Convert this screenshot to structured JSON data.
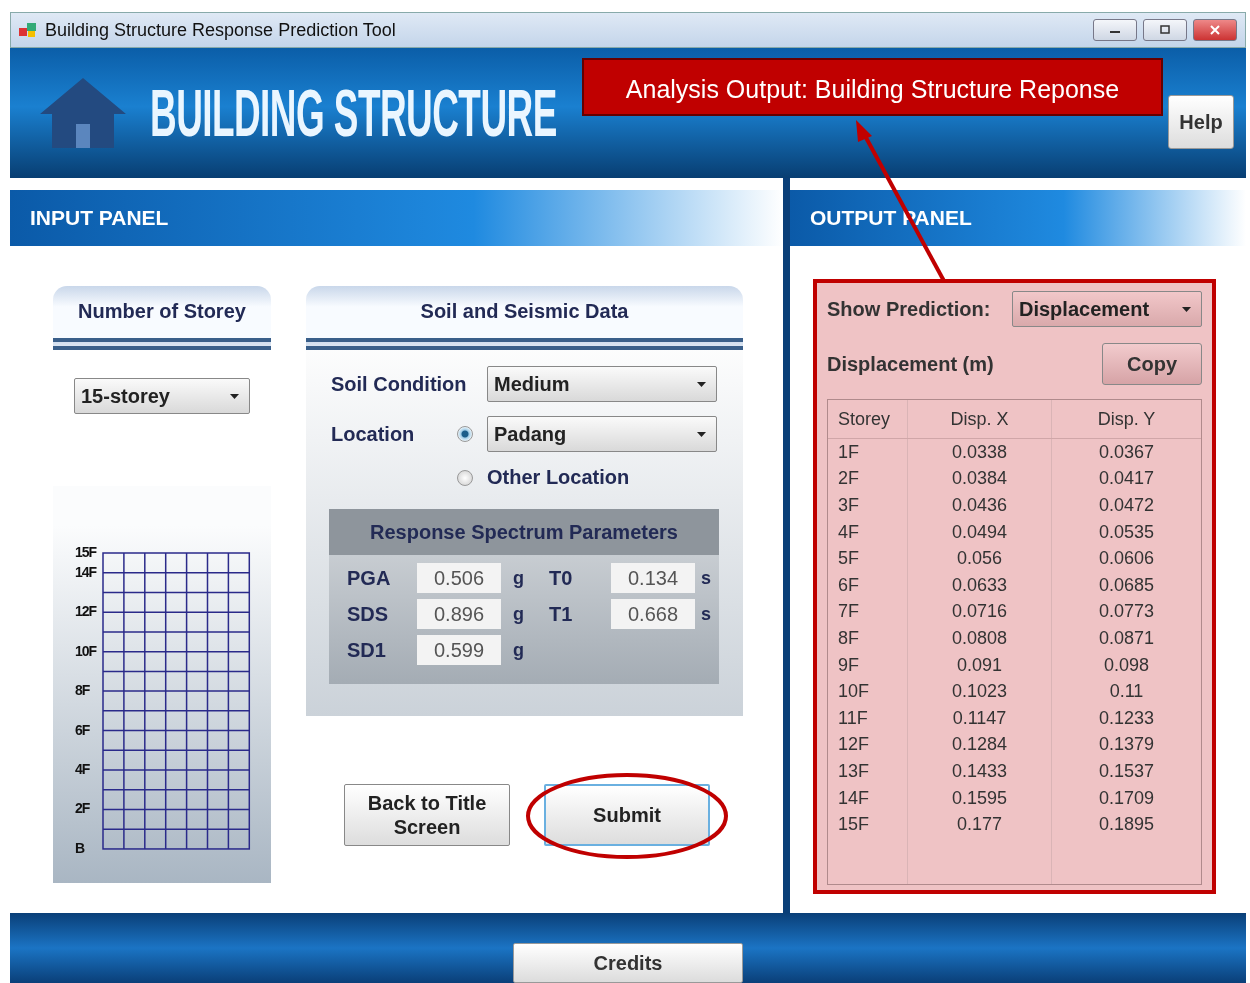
{
  "window": {
    "title": "Building Structure Response Prediction Tool"
  },
  "banner": {
    "title": "BUILDING STRUCTURE",
    "help_button": "Help"
  },
  "input_panel": {
    "title": "INPUT PANEL",
    "storey": {
      "heading": "Number of Storey",
      "selection": "15-storey",
      "floor_labels": [
        "15F",
        "14F",
        "12F",
        "10F",
        "8F",
        "6F",
        "4F",
        "2F",
        "B"
      ]
    },
    "soil": {
      "heading": "Soil and Seismic Data",
      "soil_condition_label": "Soil Condition",
      "soil_condition": "Medium",
      "location_label": "Location",
      "location_options": [
        {
          "kind": "dropdown",
          "value": "Padang",
          "selected": true
        },
        {
          "kind": "label",
          "value": "Other Location",
          "selected": false
        }
      ],
      "spectrum": {
        "heading": "Response Spectrum Parameters",
        "params": [
          {
            "label": "PGA",
            "value": "0.506",
            "unit": "g"
          },
          {
            "label": "T0",
            "value": "0.134",
            "unit": "s"
          },
          {
            "label": "SDS",
            "value": "0.896",
            "unit": "g"
          },
          {
            "label": "T1",
            "value": "0.668",
            "unit": "s"
          },
          {
            "label": "SD1",
            "value": "0.599",
            "unit": "g"
          }
        ]
      }
    },
    "buttons": [
      {
        "label": "Back to Title Screen",
        "highlighted": false
      },
      {
        "label": "Submit",
        "highlighted": true
      }
    ]
  },
  "output_panel": {
    "title": "OUTPUT PANEL",
    "show_label": "Show Prediction:",
    "show_value": "Displacement",
    "result_label": "Displacement (m)",
    "copy_button": "Copy",
    "table": {
      "columns": [
        "Storey",
        "Disp. X",
        "Disp. Y"
      ],
      "rows": [
        [
          "1F",
          "0.0338",
          "0.0367"
        ],
        [
          "2F",
          "0.0384",
          "0.0417"
        ],
        [
          "3F",
          "0.0436",
          "0.0472"
        ],
        [
          "4F",
          "0.0494",
          "0.0535"
        ],
        [
          "5F",
          "0.056",
          "0.0606"
        ],
        [
          "6F",
          "0.0633",
          "0.0685"
        ],
        [
          "7F",
          "0.0716",
          "0.0773"
        ],
        [
          "8F",
          "0.0808",
          "0.0871"
        ],
        [
          "9F",
          "0.091",
          "0.098"
        ],
        [
          "10F",
          "0.1023",
          "0.11"
        ],
        [
          "11F",
          "0.1147",
          "0.1233"
        ],
        [
          "12F",
          "0.1284",
          "0.1379"
        ],
        [
          "13F",
          "0.1433",
          "0.1537"
        ],
        [
          "14F",
          "0.1595",
          "0.1709"
        ],
        [
          "15F",
          "0.177",
          "0.1895"
        ]
      ]
    }
  },
  "annotation": {
    "callout": "Analysis Output: Building Structure Reponse"
  },
  "footer": {
    "credits_button": "Credits"
  }
}
